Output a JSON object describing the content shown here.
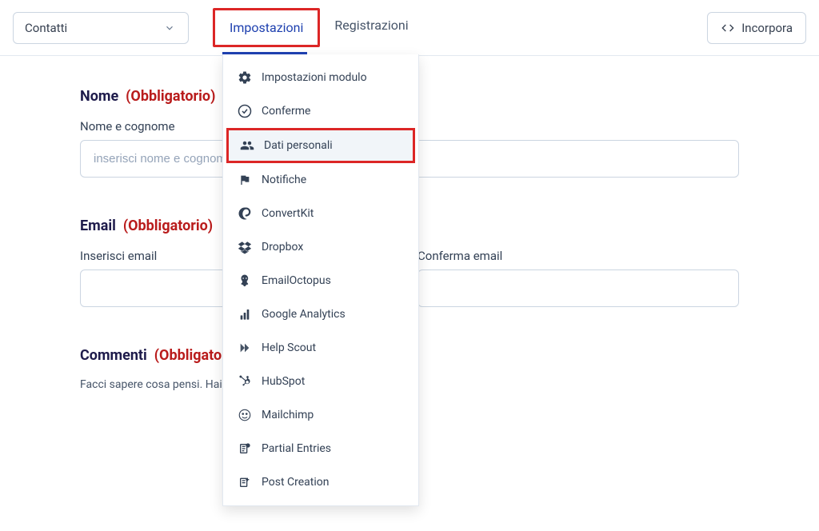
{
  "header": {
    "dropdown": {
      "value": "Contatti"
    },
    "tabs": [
      {
        "label": "Impostazioni",
        "active": true,
        "highlight": true
      },
      {
        "label": "Registrazioni",
        "active": false
      }
    ],
    "embed_label": "Incorpora"
  },
  "menu": {
    "items": [
      {
        "icon": "gear",
        "label": "Impostazioni modulo"
      },
      {
        "icon": "check-circle",
        "label": "Conferme"
      },
      {
        "icon": "users",
        "label": "Dati personali",
        "selected": true,
        "highlight": true
      },
      {
        "icon": "flag",
        "label": "Notifiche"
      },
      {
        "icon": "convertkit",
        "label": "ConvertKit"
      },
      {
        "icon": "dropbox",
        "label": "Dropbox"
      },
      {
        "icon": "octopus",
        "label": "EmailOctopus"
      },
      {
        "icon": "analytics",
        "label": "Google Analytics"
      },
      {
        "icon": "helpscout",
        "label": "Help Scout"
      },
      {
        "icon": "hubspot",
        "label": "HubSpot"
      },
      {
        "icon": "mailchimp",
        "label": "Mailchimp"
      },
      {
        "icon": "partial",
        "label": "Partial Entries"
      },
      {
        "icon": "post",
        "label": "Post Creation"
      }
    ]
  },
  "form": {
    "name": {
      "label": "Nome",
      "required": "(Obbligatorio)",
      "sub": "Nome e cognome",
      "placeholder": "inserisci nome e cognome"
    },
    "email": {
      "label": "Email",
      "required": "(Obbligatorio)",
      "sub1": "Inserisci email",
      "sub2": "Conferma email"
    },
    "comments": {
      "label": "Commenti",
      "required": "(Obbligatorio)",
      "help": "Facci sapere cosa pensi. Hai una domanda da farci? Chiedici."
    }
  }
}
